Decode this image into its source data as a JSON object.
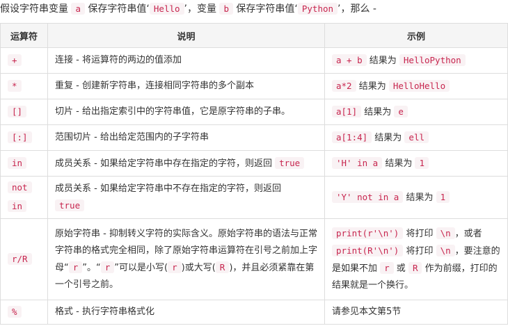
{
  "intro": {
    "p1": "假设字符串变量 ",
    "var_a": "a",
    "p2": " 保存字符串值‘",
    "val_a": "Hello",
    "p3": "’，变量 ",
    "var_b": "b",
    "p4": " 保存字符串值‘",
    "val_b": "Python",
    "p5": "’，那么 -"
  },
  "table": {
    "headers": [
      "运算符",
      "说明",
      "示例"
    ],
    "rows": [
      {
        "op": "+",
        "desc": "连接 - 将运算符的两边的值添加",
        "ex_code1": "a + b",
        "ex_text1": " 结果为 ",
        "ex_code2": "HelloPython"
      },
      {
        "op": "*",
        "desc": "重复 - 创建新字符串，连接相同字符串的多个副本",
        "ex_code1": "a*2",
        "ex_text1": " 结果为 ",
        "ex_code2": "HelloHello"
      },
      {
        "op": "[]",
        "desc": "切片 - 给出指定索引中的字符串值，它是原字符串的子串。",
        "ex_code1": "a[1]",
        "ex_text1": " 结果为 ",
        "ex_code2": "e"
      },
      {
        "op": "[:]",
        "desc": "范围切片 - 给出给定范围内的子字符串",
        "ex_code1": "a[1:4]",
        "ex_text1": " 结果为 ",
        "ex_code2": "ell"
      },
      {
        "op": "in",
        "desc": "成员关系 - 如果给定字符串中存在指定的字符，则返回 ",
        "desc_code": "true",
        "ex_code1": "'H' in a",
        "ex_text1": " 结果为 ",
        "ex_code2": "1"
      },
      {
        "op1": "not",
        "op2": "in",
        "desc": "成员关系 - 如果给定字符串中不存在指定的字符，则返回",
        "desc_code": "true",
        "ex_code1": "'Y' not in a",
        "ex_text1": " 结果为 ",
        "ex_code2": "1"
      },
      {
        "op": "r/R",
        "desc_t1": "原始字符串 - 抑制转义字符的实际含义。原始字符串的语法与正常字符串的格式完全相同，除了原始字符串运算符在引号之前加上字母“",
        "desc_c1": "r",
        "desc_t2": "”。“",
        "desc_c2": "r",
        "desc_t3": "”可以是小写(",
        "desc_c3": "r",
        "desc_t4": ")或大写(",
        "desc_c4": "R",
        "desc_t5": ")，并且必须紧靠在第一个引号之前。",
        "ex_c1": "print(r'\\n')",
        "ex_t1": " 将打印 ",
        "ex_c2": "\\n",
        "ex_t2": "，或者 ",
        "ex_c3": "print(R'\\n')",
        "ex_t3": " 将打印 ",
        "ex_c4": "\\n",
        "ex_t4": "，要注意的是如果不加 ",
        "ex_c5": "r",
        "ex_t5": " 或 ",
        "ex_c6": "R",
        "ex_t6": " 作为前缀，打印的结果就是一个换行。"
      },
      {
        "op": "%",
        "desc": "格式 - 执行字符串格式化",
        "ex": "请参见本文第5节"
      }
    ]
  }
}
